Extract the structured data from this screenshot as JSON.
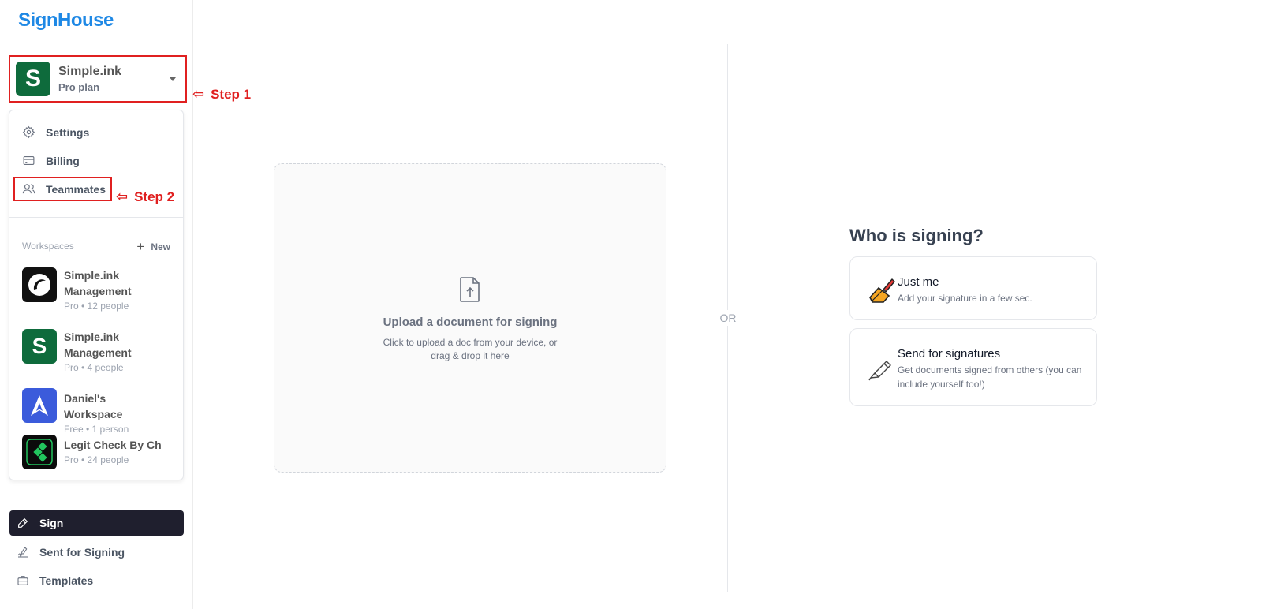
{
  "app": {
    "logo": "SignHouse"
  },
  "workspace_switcher": {
    "initial": "S",
    "name": "Simple.ink",
    "plan": "Pro plan"
  },
  "annotations": {
    "step1": "Step 1",
    "step2": "Step 2"
  },
  "menu": {
    "items": [
      {
        "label": "Settings",
        "icon": "gear-icon"
      },
      {
        "label": "Billing",
        "icon": "credit-card-icon"
      },
      {
        "label": "Teammates",
        "icon": "users-icon"
      }
    ],
    "workspaces_label": "Workspaces",
    "new_label": "New",
    "workspaces": [
      {
        "name": "Simple.ink Management",
        "meta": "Pro • 12 people",
        "logo": "black-circle-logo"
      },
      {
        "name": "Simple.ink Management",
        "meta": "Pro • 4 people",
        "logo": "green-s-logo",
        "initial": "S"
      },
      {
        "name": "Daniel's Workspace",
        "meta": "Free • 1 person",
        "logo": "blue-arrow-logo"
      },
      {
        "name": "Legit Check By Ch",
        "meta": "Pro • 24 people",
        "logo": "green-diamond-logo"
      }
    ]
  },
  "nav": {
    "items": [
      {
        "label": "Sign",
        "icon": "pen-icon",
        "active": true
      },
      {
        "label": "Sent for Signing",
        "icon": "signature-icon",
        "active": false
      },
      {
        "label": "Templates",
        "icon": "briefcase-icon",
        "active": false
      }
    ]
  },
  "upload": {
    "icon": "file-upload-icon",
    "title": "Upload a document for signing",
    "sub_line1": "Click to upload a doc from your device, or",
    "sub_line2": "drag & drop it here"
  },
  "divider_label": "OR",
  "signing": {
    "heading": "Who is signing?",
    "options": [
      {
        "title": "Just me",
        "desc": "Add your signature in a few sec.",
        "icon": "writing-hand-icon"
      },
      {
        "title": "Send for signatures",
        "desc": "Get documents signed from others (you can include yourself too!)",
        "icon": "fountain-pen-icon"
      }
    ]
  },
  "colors": {
    "brand": "#1e88e5",
    "workspace_green": "#0e6b3c",
    "nav_active": "#1f1f2e",
    "annotation_red": "#e02020"
  }
}
